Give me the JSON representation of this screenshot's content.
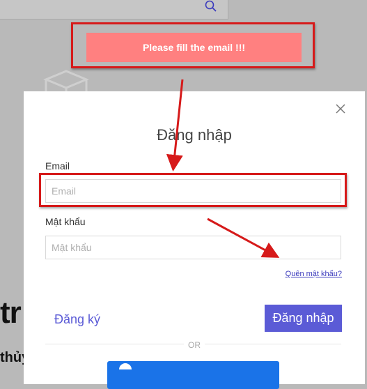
{
  "background": {
    "heading_partial": "tr",
    "sub_partial": "thủy"
  },
  "toast": {
    "message": "Please fill the email !!!"
  },
  "modal": {
    "title": "Đăng nhập",
    "email": {
      "label": "Email",
      "placeholder": "Email",
      "value": ""
    },
    "password": {
      "label": "Mật khẩu",
      "placeholder": "Mật khẩu",
      "value": ""
    },
    "forgot_link": "Quên mật khẩu?",
    "register_link": "Đăng ký",
    "login_button": "Đăng nhập",
    "divider_text": "OR"
  },
  "icons": [
    "search-icon",
    "box-icon",
    "close-icon",
    "social-login-icon"
  ],
  "colors": {
    "accent": "#5b5bd6",
    "toast_bg": "#ff8080",
    "annotation": "#d61a1a",
    "overlay": "#b9b9b9"
  }
}
